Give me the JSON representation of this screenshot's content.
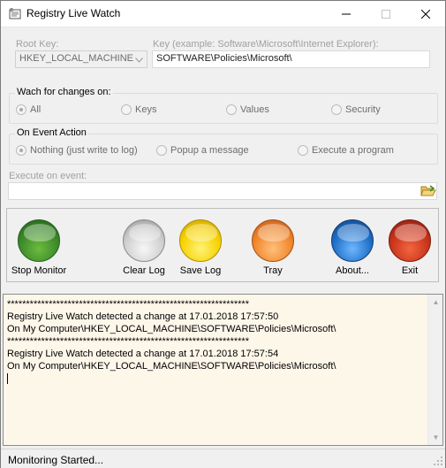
{
  "window": {
    "title": "Registry Live Watch"
  },
  "root_key": {
    "label": "Root Key:",
    "value": "HKEY_LOCAL_MACHINE"
  },
  "key": {
    "label": "Key (example: Software\\Microsoft\\Internet Explorer):",
    "value": "SOFTWARE\\Policies\\Microsoft\\"
  },
  "watch": {
    "title": "Wach for changes on:",
    "options": [
      {
        "label": "All",
        "checked": true
      },
      {
        "label": "Keys",
        "checked": false
      },
      {
        "label": "Values",
        "checked": false
      },
      {
        "label": "Security",
        "checked": false
      }
    ]
  },
  "event_action": {
    "title": "On Event Action",
    "options": [
      {
        "label": "Nothing (just write to log)",
        "checked": true
      },
      {
        "label": "Popup a message",
        "checked": false
      },
      {
        "label": "Execute a program",
        "checked": false
      }
    ]
  },
  "execute": {
    "label": "Execute on event:",
    "value": "",
    "icon": "folder-open-icon"
  },
  "buttons": [
    {
      "label": "Stop Monitor",
      "color": "#3b8a2a"
    },
    {
      "label": "Clear Log",
      "color": "#d0d0d0"
    },
    {
      "label": "Save Log",
      "color": "#f6d200"
    },
    {
      "label": "Tray",
      "color": "#f0862b"
    },
    {
      "label": "About...",
      "color": "#1e6fc6"
    },
    {
      "label": "Exit",
      "color": "#c8331a"
    }
  ],
  "log": {
    "lines": [
      "****************************************************************",
      "Registry Live Watch detected a change at 17.01.2018 17:57:50",
      "On My Computer\\HKEY_LOCAL_MACHINE\\SOFTWARE\\Policies\\Microsoft\\",
      "****************************************************************",
      "Registry Live Watch detected a change at 17.01.2018 17:57:54",
      "On My Computer\\HKEY_LOCAL_MACHINE\\SOFTWARE\\Policies\\Microsoft\\"
    ]
  },
  "status": {
    "text": "Monitoring Started..."
  }
}
